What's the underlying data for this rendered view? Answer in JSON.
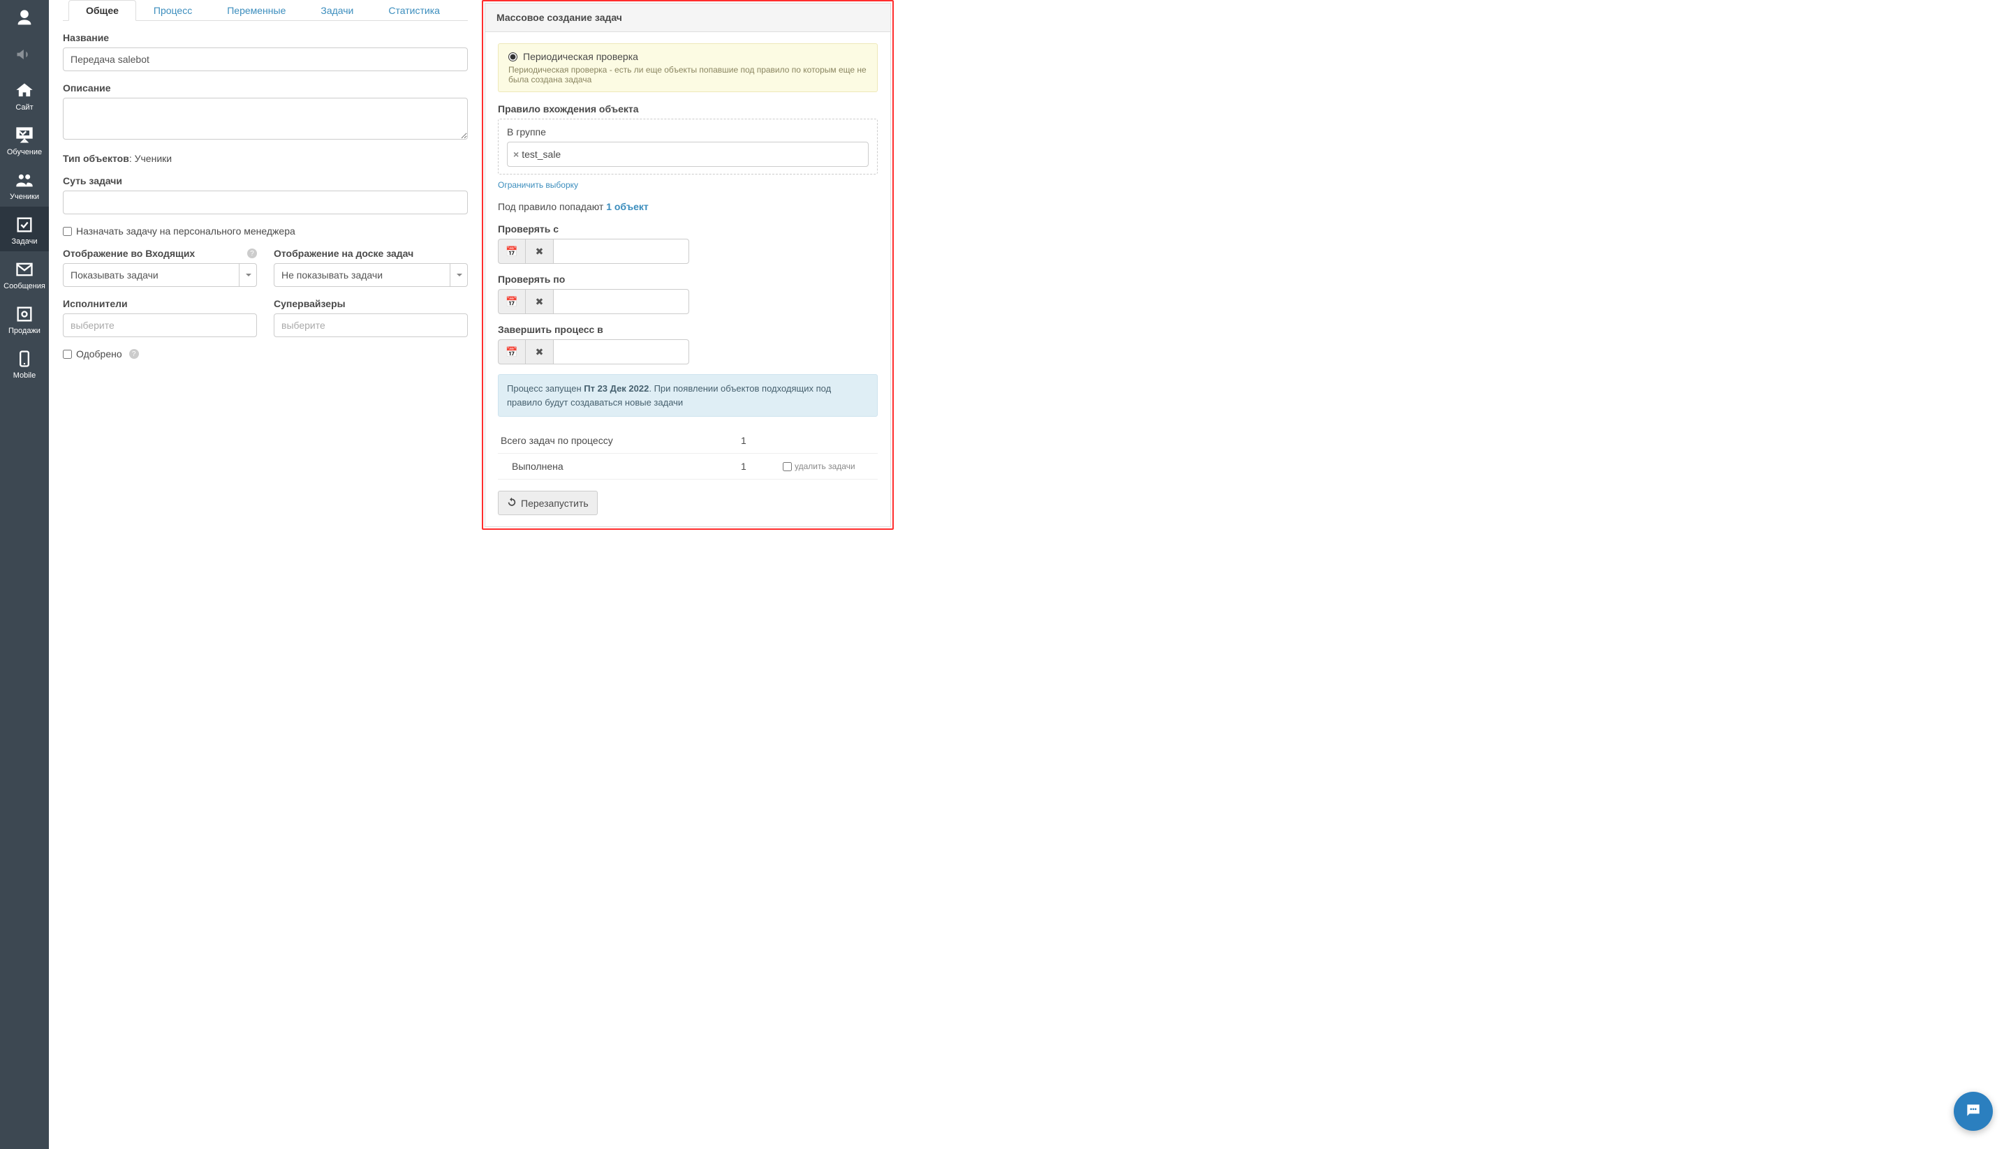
{
  "sidebar": {
    "items": [
      {
        "key": "avatar",
        "label": ""
      },
      {
        "key": "announce",
        "label": ""
      },
      {
        "key": "site",
        "label": "Сайт"
      },
      {
        "key": "learning",
        "label": "Обучение"
      },
      {
        "key": "students",
        "label": "Ученики"
      },
      {
        "key": "tasks",
        "label": "Задачи"
      },
      {
        "key": "messages",
        "label": "Сообщения"
      },
      {
        "key": "sales",
        "label": "Продажи"
      },
      {
        "key": "mobile",
        "label": "Mobile"
      }
    ]
  },
  "tabs": [
    {
      "key": "general",
      "label": "Общее"
    },
    {
      "key": "process",
      "label": "Процесс"
    },
    {
      "key": "vars",
      "label": "Переменные"
    },
    {
      "key": "tasks",
      "label": "Задачи"
    },
    {
      "key": "stats",
      "label": "Статистика"
    }
  ],
  "form": {
    "name_label": "Название",
    "name_value": "Передача salebot",
    "desc_label": "Описание",
    "desc_value": "",
    "obj_type_label": "Тип объектов",
    "obj_type_value": "Ученики",
    "essence_label": "Суть задачи",
    "essence_value": "",
    "assign_personal": "Назначать задачу на персонального менеджера",
    "inbox_display_label": "Отображение во Входящих",
    "inbox_display_value": "Показывать задачи",
    "board_display_label": "Отображение на доске задач",
    "board_display_value": "Не показывать задачи",
    "assignees_label": "Исполнители",
    "assignees_placeholder": "выберите",
    "supervisors_label": "Супервайзеры",
    "supervisors_placeholder": "выберите",
    "approved_label": "Одобрено"
  },
  "mass": {
    "title": "Массовое создание задач",
    "periodic_label": "Периодическая проверка",
    "periodic_desc": "Периодическая проверка - есть ли еще объекты попавшие под правило по которым еще не была создана задача",
    "rule_label": "Правило вхождения объекта",
    "rule_group_label": "В группе",
    "rule_tag": "test_sale",
    "limit_link": "Ограничить выборку",
    "hits_prefix": "Под правило попадают ",
    "hits_count": "1 объект",
    "check_from_label": "Проверять с",
    "check_to_label": "Проверять по",
    "finish_label": "Завершить процесс в",
    "process_started_prefix": "Процесс запущен ",
    "process_started_date": "Пт 23 Дек 2022",
    "process_started_suffix": ". При появлении объектов подходящих под правило будут создаваться новые задачи",
    "total_tasks_label": "Всего задач по процессу",
    "total_tasks_value": "1",
    "done_label": "Выполнена",
    "done_value": "1",
    "delete_tasks_label": "удалить задачи",
    "restart_label": "Перезапустить"
  }
}
